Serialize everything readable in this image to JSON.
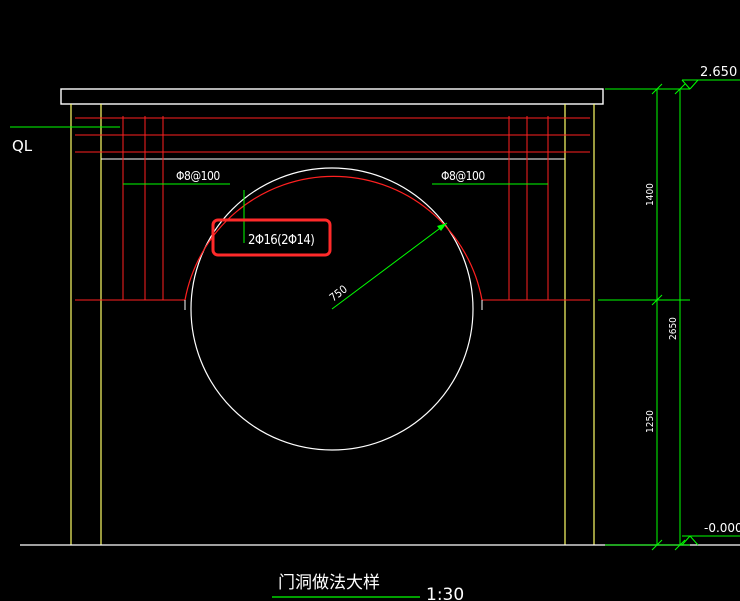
{
  "drawing": {
    "title": "门洞做法大样",
    "scale": "1:30",
    "ql_label": "QL",
    "rebar_left": "Φ8@100",
    "rebar_right": "Φ8@100",
    "main_rebar": "2Φ16(2Φ14)",
    "radius_dim": "750",
    "dim_upper": "1400",
    "dim_total": "2650",
    "dim_lower": "1250",
    "elev_top": "2.650",
    "elev_bottom": "-0.000"
  },
  "colors": {
    "background": "#000000",
    "wall": "#ffff66",
    "slab": "#ffffff",
    "rebar": "#ff2020",
    "dimension": "#00ff00",
    "highlight": "#ff2a2a",
    "text": "#ffffff"
  }
}
